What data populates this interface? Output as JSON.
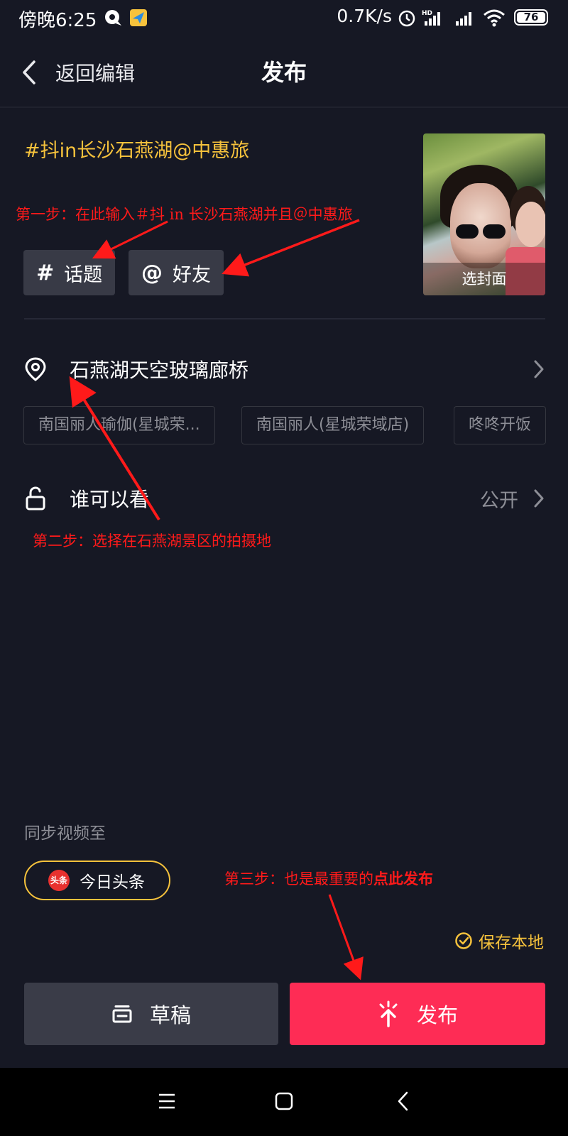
{
  "status_bar": {
    "time": "傍晚6:25",
    "speed": "0.7K/s",
    "battery": "76",
    "icons": [
      "message-icon",
      "flight-app-icon",
      "alarm-icon",
      "hd-signal-icon",
      "signal-icon",
      "wifi-icon",
      "battery-icon"
    ]
  },
  "nav": {
    "back_label": "返回编辑",
    "title": "发布"
  },
  "post": {
    "caption": "#抖in长沙石燕湖@中惠旅",
    "cover_label": "选封面",
    "topic_chip": "话题",
    "friend_chip": "好友"
  },
  "location": {
    "label": "石燕湖天空玻璃廊桥",
    "suggestions": [
      "南国丽人瑜伽(星城荣...",
      "南国丽人(星城荣域店)",
      "咚咚开饭"
    ]
  },
  "visibility": {
    "label": "谁可以看",
    "value": "公开"
  },
  "sync": {
    "label": "同步视频至",
    "logo_text": "头条",
    "toutiao_label": "今日头条"
  },
  "save_local": "保存本地",
  "buttons": {
    "draft": "草稿",
    "publish": "发布"
  },
  "annotations": {
    "step1": "第一步：在此输入＃抖 in 长沙石燕湖并且＠中惠旅",
    "step2": "第二步：选择在石燕湖景区的拍摄地",
    "step3_prefix": "第三步：也是最重要的",
    "step3_emph": "点此发布"
  },
  "colors": {
    "background": "#161824",
    "accent_yellow": "#f6c23c",
    "publish_red": "#fe2c55",
    "annotation_red": "#ff1a1a"
  }
}
